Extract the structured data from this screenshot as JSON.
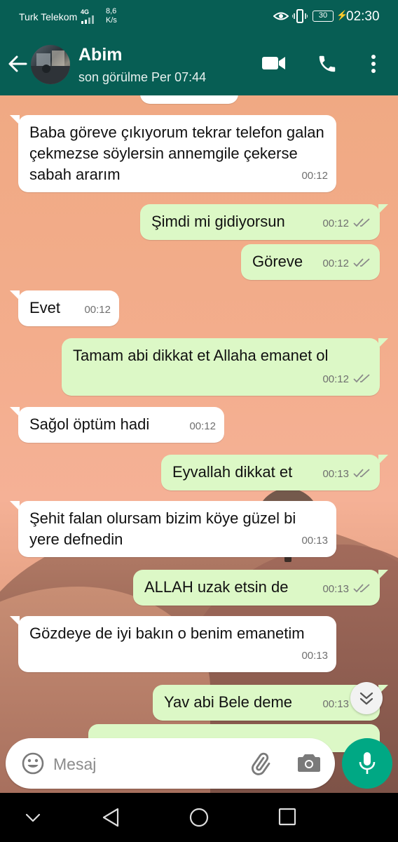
{
  "status_bar": {
    "carrier": "Turk Telekom",
    "network": "4G",
    "speed_value": "8,6",
    "speed_unit": "K/s",
    "battery": "30",
    "time": "02:30"
  },
  "header": {
    "contact_name": "Abim",
    "last_seen": "son görülme Per 07:44",
    "theme_color": "#075E54"
  },
  "messages": [
    {
      "direction": "in",
      "text": "Baba göreve çıkıyorum tekrar telefon galan çekmezse söylersin annemgile çekerse sabah ararım",
      "time": "00:12"
    },
    {
      "direction": "out",
      "text": "Şimdi mi gidiyorsun",
      "time": "00:12"
    },
    {
      "direction": "out",
      "text": "Göreve",
      "time": "00:12"
    },
    {
      "direction": "in",
      "text": "Evet",
      "time": "00:12"
    },
    {
      "direction": "out",
      "text": "Tamam abi dikkat et Allaha emanet ol",
      "time": "00:12"
    },
    {
      "direction": "in",
      "text": "Sağol öptüm hadi",
      "time": "00:12"
    },
    {
      "direction": "out",
      "text": "Eyvallah dikkat et",
      "time": "00:13"
    },
    {
      "direction": "in",
      "text": "Şehit falan olursam bizim köye güzel bi yere defnedin",
      "time": "00:13"
    },
    {
      "direction": "out",
      "text": "ALLAH uzak etsin de",
      "time": "00:13"
    },
    {
      "direction": "in",
      "text": "Gözdeye de iyi bakın o benim emanetim",
      "time": "00:13"
    },
    {
      "direction": "out",
      "text": "Yav abi Bele deme",
      "time": "00:13"
    }
  ],
  "input": {
    "placeholder": "Mesaj"
  },
  "colors": {
    "incoming_bubble": "#ffffff",
    "outgoing_bubble": "#dcf8c6",
    "mic_button": "#00a884"
  }
}
